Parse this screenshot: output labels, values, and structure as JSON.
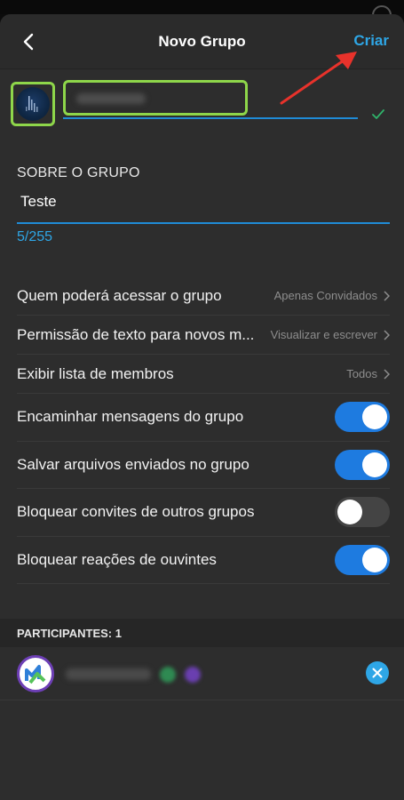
{
  "header": {
    "title": "Novo Grupo",
    "create_label": "Criar"
  },
  "about": {
    "section_label": "SOBRE O GRUPO",
    "value": "Teste",
    "counter": "5/255"
  },
  "settings": [
    {
      "label": "Quem poderá acessar o grupo",
      "value": "Apenas Convidados",
      "type": "nav"
    },
    {
      "label": "Permissão de texto para novos m...",
      "value": "Visualizar e escrever",
      "type": "nav"
    },
    {
      "label": "Exibir lista de membros",
      "value": "Todos",
      "type": "nav"
    },
    {
      "label": "Encaminhar mensagens do grupo",
      "state": "on",
      "type": "toggle"
    },
    {
      "label": "Salvar arquivos enviados no grupo",
      "state": "on",
      "type": "toggle"
    },
    {
      "label": "Bloquear convites de outros grupos",
      "state": "off",
      "type": "toggle"
    },
    {
      "label": "Bloquear reações de ouvintes",
      "state": "on",
      "type": "toggle"
    }
  ],
  "participants": {
    "header": "PARTICIPANTES: 1"
  },
  "colors": {
    "accent": "#2ea6e6",
    "toggle_on": "#1e7be0",
    "highlight": "#8ed64a",
    "annotation_arrow": "#e8322b"
  },
  "icons": {
    "back": "chevron-left-icon",
    "check": "check-icon",
    "remove": "close-icon"
  }
}
